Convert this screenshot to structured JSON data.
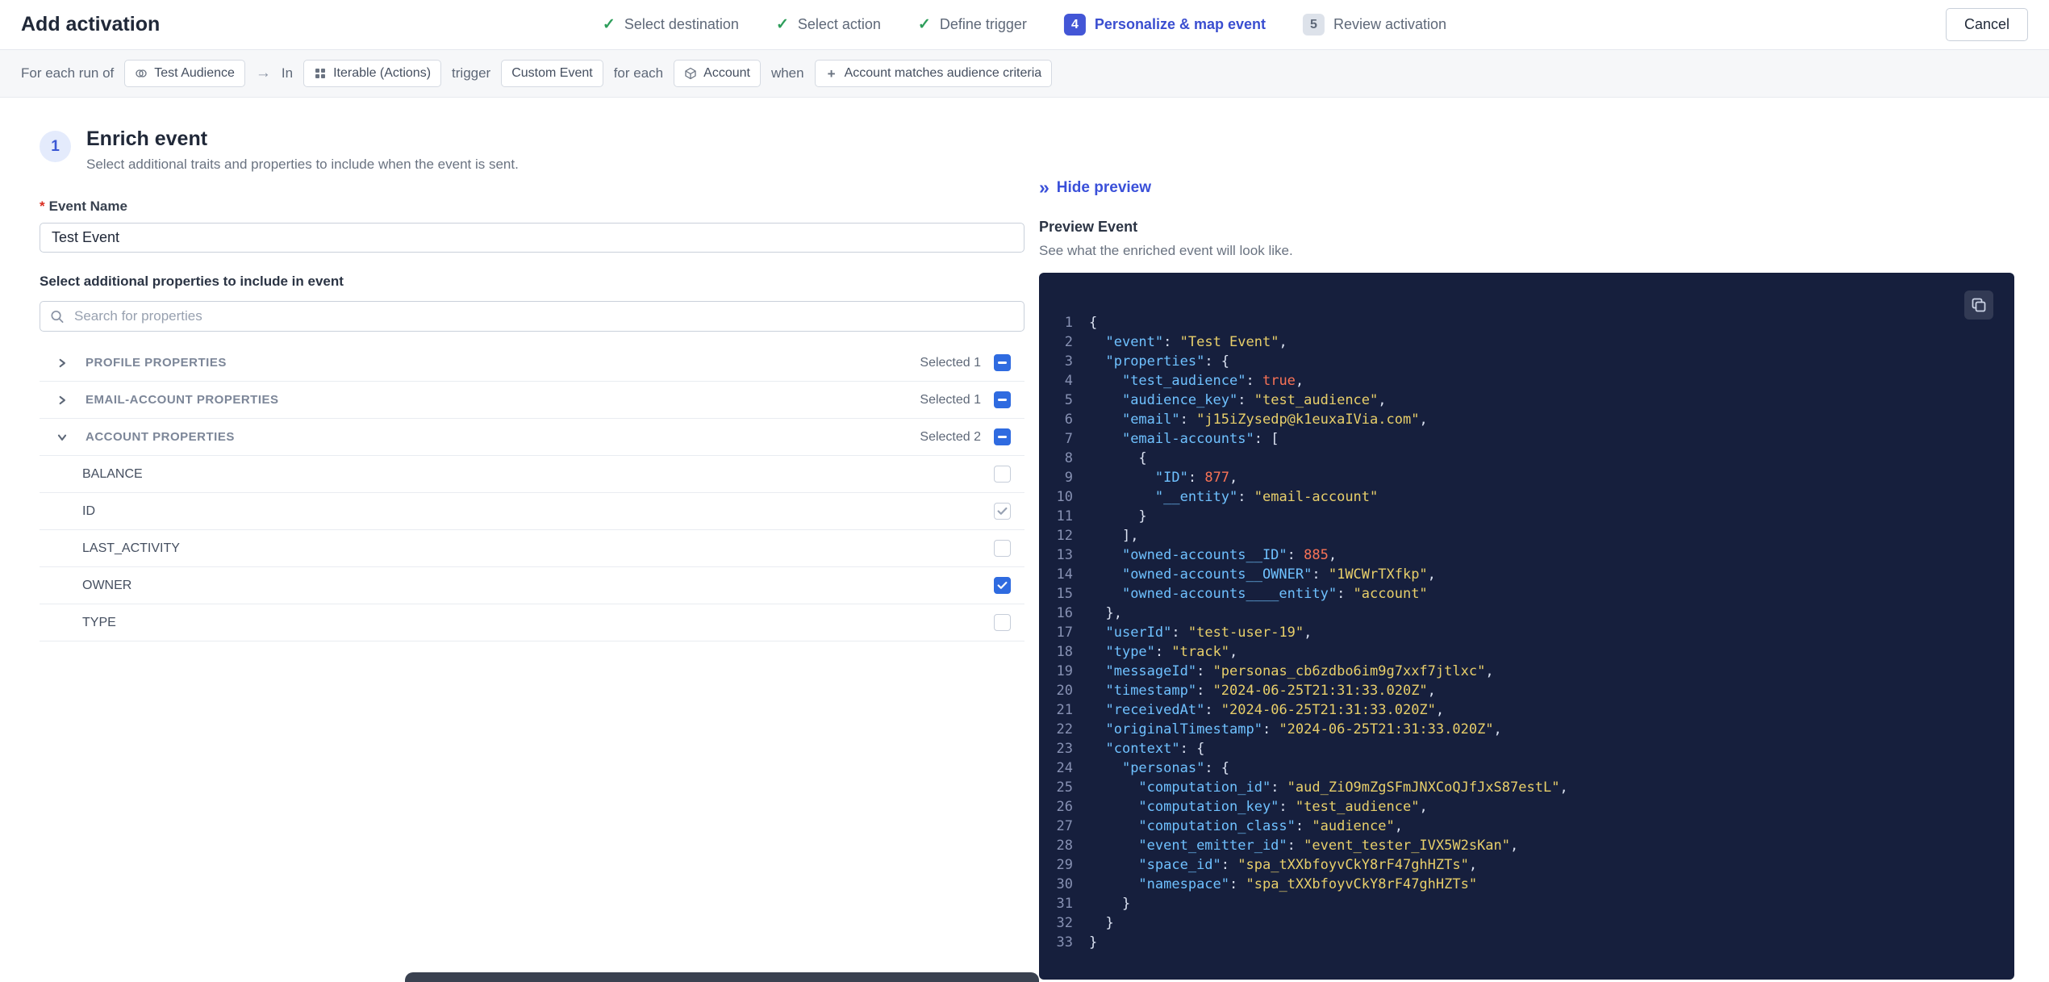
{
  "header": {
    "title": "Add activation",
    "cancel_label": "Cancel",
    "steps": [
      {
        "label": "Select destination",
        "status": "done"
      },
      {
        "label": "Select action",
        "status": "done"
      },
      {
        "label": "Define trigger",
        "status": "done"
      },
      {
        "label": "Personalize & map event",
        "status": "active",
        "number": "4"
      },
      {
        "label": "Review activation",
        "status": "upcoming",
        "number": "5"
      }
    ]
  },
  "trigger_bar": {
    "segments": [
      {
        "type": "text",
        "text": "For each run of"
      },
      {
        "type": "chip",
        "icon": "audience-icon",
        "label": "Test Audience"
      },
      {
        "type": "arrow",
        "text": "→"
      },
      {
        "type": "text",
        "text": "In"
      },
      {
        "type": "chip",
        "icon": "grid-icon",
        "label": "Iterable (Actions)"
      },
      {
        "type": "text",
        "text": "trigger"
      },
      {
        "type": "chip",
        "label": "Custom Event"
      },
      {
        "type": "text",
        "text": "for each"
      },
      {
        "type": "chip",
        "icon": "cube-icon",
        "label": "Account"
      },
      {
        "type": "text",
        "text": "when"
      },
      {
        "type": "chip",
        "icon": "plus-icon",
        "label": "Account matches audience criteria"
      }
    ]
  },
  "enrich": {
    "step_number": "1",
    "title": "Enrich event",
    "subtitle": "Select additional traits and properties to include when the event is sent.",
    "required_marker": "*",
    "event_name_label": "Event Name",
    "event_name_value": "Test Event",
    "properties_label": "Select additional properties to include in event",
    "search_placeholder": "Search for properties",
    "groups": [
      {
        "label": "PROFILE PROPERTIES",
        "selected_text": "Selected 1",
        "expanded": false,
        "checkbox": "indeterminate",
        "children": []
      },
      {
        "label": "EMAIL-ACCOUNT PROPERTIES",
        "selected_text": "Selected 1",
        "expanded": false,
        "checkbox": "indeterminate",
        "children": []
      },
      {
        "label": "ACCOUNT PROPERTIES",
        "selected_text": "Selected 2",
        "expanded": true,
        "checkbox": "indeterminate",
        "children": [
          {
            "label": "BALANCE",
            "checkbox": "unchecked"
          },
          {
            "label": "ID",
            "checkbox": "checked_disabled"
          },
          {
            "label": "LAST_ACTIVITY",
            "checkbox": "unchecked"
          },
          {
            "label": "OWNER",
            "checkbox": "checked"
          },
          {
            "label": "TYPE",
            "checkbox": "unchecked"
          }
        ]
      }
    ]
  },
  "preview": {
    "hide_link": "Hide preview",
    "title": "Preview Event",
    "subtitle": "See what the enriched event will look like.",
    "code_lines": [
      [
        [
          "p",
          "{"
        ]
      ],
      [
        [
          "w",
          "  "
        ],
        [
          "k",
          "\"event\""
        ],
        [
          "p",
          ": "
        ],
        [
          "s",
          "\"Test Event\""
        ],
        [
          "p",
          ","
        ]
      ],
      [
        [
          "w",
          "  "
        ],
        [
          "k",
          "\"properties\""
        ],
        [
          "p",
          ": {"
        ]
      ],
      [
        [
          "w",
          "    "
        ],
        [
          "k",
          "\"test_audience\""
        ],
        [
          "p",
          ": "
        ],
        [
          "b",
          "true"
        ],
        [
          "p",
          ","
        ]
      ],
      [
        [
          "w",
          "    "
        ],
        [
          "k",
          "\"audience_key\""
        ],
        [
          "p",
          ": "
        ],
        [
          "s",
          "\"test_audience\""
        ],
        [
          "p",
          ","
        ]
      ],
      [
        [
          "w",
          "    "
        ],
        [
          "k",
          "\"email\""
        ],
        [
          "p",
          ": "
        ],
        [
          "s",
          "\"j15iZysedp@k1euxaIVia.com\""
        ],
        [
          "p",
          ","
        ]
      ],
      [
        [
          "w",
          "    "
        ],
        [
          "k",
          "\"email-accounts\""
        ],
        [
          "p",
          ": ["
        ]
      ],
      [
        [
          "w",
          "      "
        ],
        [
          "p",
          "{"
        ]
      ],
      [
        [
          "w",
          "        "
        ],
        [
          "k",
          "\"ID\""
        ],
        [
          "p",
          ": "
        ],
        [
          "n",
          "877"
        ],
        [
          "p",
          ","
        ]
      ],
      [
        [
          "w",
          "        "
        ],
        [
          "k",
          "\"__entity\""
        ],
        [
          "p",
          ": "
        ],
        [
          "s",
          "\"email-account\""
        ]
      ],
      [
        [
          "w",
          "      "
        ],
        [
          "p",
          "}"
        ]
      ],
      [
        [
          "w",
          "    "
        ],
        [
          "p",
          "],"
        ]
      ],
      [
        [
          "w",
          "    "
        ],
        [
          "k",
          "\"owned-accounts__ID\""
        ],
        [
          "p",
          ": "
        ],
        [
          "n",
          "885"
        ],
        [
          "p",
          ","
        ]
      ],
      [
        [
          "w",
          "    "
        ],
        [
          "k",
          "\"owned-accounts__OWNER\""
        ],
        [
          "p",
          ": "
        ],
        [
          "s",
          "\"1WCWrTXfkp\""
        ],
        [
          "p",
          ","
        ]
      ],
      [
        [
          "w",
          "    "
        ],
        [
          "k",
          "\"owned-accounts____entity\""
        ],
        [
          "p",
          ": "
        ],
        [
          "s",
          "\"account\""
        ]
      ],
      [
        [
          "w",
          "  "
        ],
        [
          "p",
          "},"
        ]
      ],
      [
        [
          "w",
          "  "
        ],
        [
          "k",
          "\"userId\""
        ],
        [
          "p",
          ": "
        ],
        [
          "s",
          "\"test-user-19\""
        ],
        [
          "p",
          ","
        ]
      ],
      [
        [
          "w",
          "  "
        ],
        [
          "k",
          "\"type\""
        ],
        [
          "p",
          ": "
        ],
        [
          "s",
          "\"track\""
        ],
        [
          "p",
          ","
        ]
      ],
      [
        [
          "w",
          "  "
        ],
        [
          "k",
          "\"messageId\""
        ],
        [
          "p",
          ": "
        ],
        [
          "s",
          "\"personas_cb6zdbo6im9g7xxf7jtlxc\""
        ],
        [
          "p",
          ","
        ]
      ],
      [
        [
          "w",
          "  "
        ],
        [
          "k",
          "\"timestamp\""
        ],
        [
          "p",
          ": "
        ],
        [
          "s",
          "\"2024-06-25T21:31:33.020Z\""
        ],
        [
          "p",
          ","
        ]
      ],
      [
        [
          "w",
          "  "
        ],
        [
          "k",
          "\"receivedAt\""
        ],
        [
          "p",
          ": "
        ],
        [
          "s",
          "\"2024-06-25T21:31:33.020Z\""
        ],
        [
          "p",
          ","
        ]
      ],
      [
        [
          "w",
          "  "
        ],
        [
          "k",
          "\"originalTimestamp\""
        ],
        [
          "p",
          ": "
        ],
        [
          "s",
          "\"2024-06-25T21:31:33.020Z\""
        ],
        [
          "p",
          ","
        ]
      ],
      [
        [
          "w",
          "  "
        ],
        [
          "k",
          "\"context\""
        ],
        [
          "p",
          ": {"
        ]
      ],
      [
        [
          "w",
          "    "
        ],
        [
          "k",
          "\"personas\""
        ],
        [
          "p",
          ": {"
        ]
      ],
      [
        [
          "w",
          "      "
        ],
        [
          "k",
          "\"computation_id\""
        ],
        [
          "p",
          ": "
        ],
        [
          "s",
          "\"aud_ZiO9mZgSFmJNXCoQJfJxS87estL\""
        ],
        [
          "p",
          ","
        ]
      ],
      [
        [
          "w",
          "      "
        ],
        [
          "k",
          "\"computation_key\""
        ],
        [
          "p",
          ": "
        ],
        [
          "s",
          "\"test_audience\""
        ],
        [
          "p",
          ","
        ]
      ],
      [
        [
          "w",
          "      "
        ],
        [
          "k",
          "\"computation_class\""
        ],
        [
          "p",
          ": "
        ],
        [
          "s",
          "\"audience\""
        ],
        [
          "p",
          ","
        ]
      ],
      [
        [
          "w",
          "      "
        ],
        [
          "k",
          "\"event_emitter_id\""
        ],
        [
          "p",
          ": "
        ],
        [
          "s",
          "\"event_tester_IVX5W2sKan\""
        ],
        [
          "p",
          ","
        ]
      ],
      [
        [
          "w",
          "      "
        ],
        [
          "k",
          "\"space_id\""
        ],
        [
          "p",
          ": "
        ],
        [
          "s",
          "\"spa_tXXbfoyvCkY8rF47ghHZTs\""
        ],
        [
          "p",
          ","
        ]
      ],
      [
        [
          "w",
          "      "
        ],
        [
          "k",
          "\"namespace\""
        ],
        [
          "p",
          ": "
        ],
        [
          "s",
          "\"spa_tXXbfoyvCkY8rF47ghHZTs\""
        ]
      ],
      [
        [
          "w",
          "    "
        ],
        [
          "p",
          "}"
        ]
      ],
      [
        [
          "w",
          "  "
        ],
        [
          "p",
          "}"
        ]
      ],
      [
        [
          "p",
          "}"
        ]
      ]
    ]
  },
  "colors": {
    "accent_blue": "#4356d6",
    "link_blue": "#3a50d9",
    "success_green": "#2e9e5b",
    "checkbox_blue": "#2f6be0",
    "required_red": "#d92d20",
    "code_bg": "#161f3d",
    "code_key": "#6fc1ff",
    "code_string": "#e8cf6a",
    "code_number": "#f97356",
    "code_boolean": "#f97356",
    "code_line_number": "#8791b3"
  }
}
